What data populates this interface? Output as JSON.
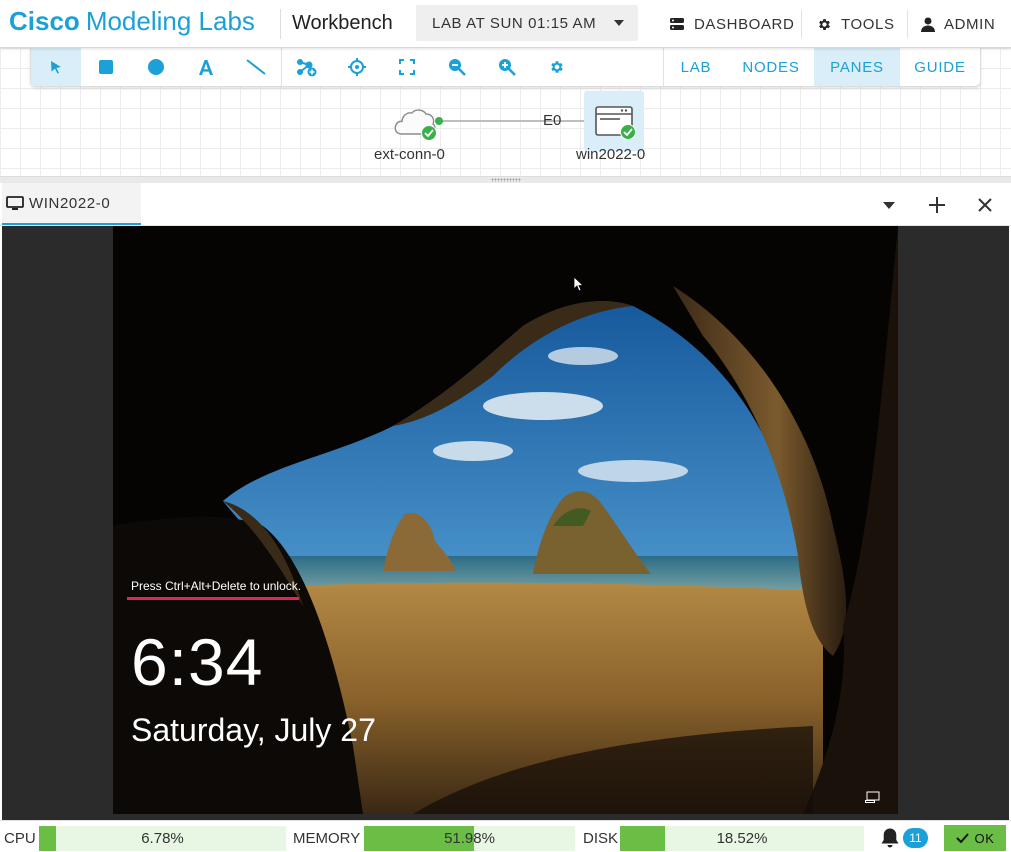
{
  "header": {
    "brand_bold": "Cisco",
    "brand_rest": "Modeling Labs",
    "app_title": "Workbench",
    "lab_selector": "LAB AT SUN 01:15 AM",
    "nav": {
      "dashboard": "DASHBOARD",
      "tools": "TOOLS",
      "admin": "ADMIN"
    }
  },
  "toolbar": {
    "tools": [
      {
        "name": "select-tool",
        "icon": "pointer-icon",
        "active": true
      },
      {
        "name": "rectangle-tool",
        "icon": "square-icon"
      },
      {
        "name": "ellipse-tool",
        "icon": "circle-icon"
      },
      {
        "name": "text-tool",
        "icon": "text-a-icon"
      },
      {
        "name": "line-tool",
        "icon": "line-icon"
      },
      {
        "name": "add-node-tool",
        "icon": "add-node-icon"
      },
      {
        "name": "center-tool",
        "icon": "crosshair-icon"
      },
      {
        "name": "fit-tool",
        "icon": "fit-screen-icon"
      },
      {
        "name": "zoom-out-tool",
        "icon": "zoom-out-icon"
      },
      {
        "name": "zoom-in-tool",
        "icon": "zoom-in-icon"
      },
      {
        "name": "settings-tool",
        "icon": "gear-icon"
      }
    ],
    "tabs": {
      "lab": "LAB",
      "nodes": "NODES",
      "panes": "PANES",
      "guide": "GUIDE"
    },
    "active_tab": "PANES"
  },
  "topology": {
    "nodes": [
      {
        "label": "ext-conn-0",
        "icon": "cloud-icon",
        "state": "booted"
      },
      {
        "label": "win2022-0",
        "icon": "server-window-icon",
        "state": "booted",
        "selected": true
      }
    ],
    "link_label": "E0"
  },
  "pane": {
    "tab_label": "WIN2022-0",
    "console": {
      "unlock_hint": "Press Ctrl+Alt+Delete to unlock.",
      "time": "6:34",
      "date": "Saturday, July 27"
    }
  },
  "status": {
    "cpu": {
      "label": "CPU",
      "value": "6.78%",
      "fraction": 0.0678
    },
    "memory": {
      "label": "MEMORY",
      "value": "51.98%",
      "fraction": 0.5198
    },
    "disk": {
      "label": "DISK",
      "value": "18.52%",
      "fraction": 0.1852
    },
    "notifications": "11",
    "ok_label": "OK"
  },
  "colors": {
    "brand": "#1ba0d7",
    "status_ok": "#3ab04b",
    "meter_fill": "#6abe45",
    "unlock_bar": "#e0245e"
  }
}
